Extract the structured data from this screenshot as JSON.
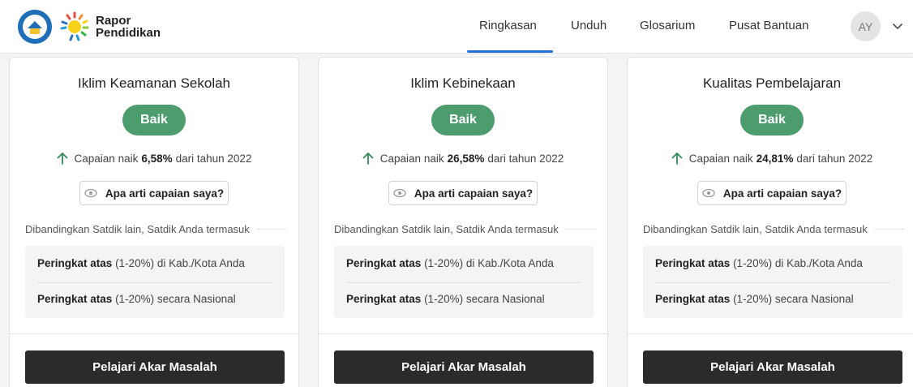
{
  "header": {
    "brand_line1": "Rapor",
    "brand_line2": "Pendidikan",
    "nav": [
      "Ringkasan",
      "Unduh",
      "Glosarium",
      "Pusat Bantuan"
    ],
    "active_tab": "Ringkasan",
    "avatar_initials": "AY",
    "accent_color": "#1f6fd6"
  },
  "cards": [
    {
      "title": "Iklim Keamanan Sekolah",
      "badge": "Baik",
      "trend_prefix": "Capaian naik",
      "trend_value": "6,58%",
      "trend_suffix": "dari tahun 2022",
      "info_button": "Apa arti capaian saya?",
      "compare_label": "Dibandingkan Satdik lain, Satdik Anda termasuk",
      "rank1_bold": "Peringkat atas",
      "rank1_rest": "(1-20%) di Kab./Kota Anda",
      "rank2_bold": "Peringkat atas",
      "rank2_rest": "(1-20%) secara Nasional",
      "action": "Pelajari Akar Masalah"
    },
    {
      "title": "Iklim Kebinekaan",
      "badge": "Baik",
      "trend_prefix": "Capaian naik",
      "trend_value": "26,58%",
      "trend_suffix": "dari tahun 2022",
      "info_button": "Apa arti capaian saya?",
      "compare_label": "Dibandingkan Satdik lain, Satdik Anda termasuk",
      "rank1_bold": "Peringkat atas",
      "rank1_rest": "(1-20%) di Kab./Kota Anda",
      "rank2_bold": "Peringkat atas",
      "rank2_rest": "(1-20%) secara Nasional",
      "action": "Pelajari Akar Masalah"
    },
    {
      "title": "Kualitas Pembelajaran",
      "badge": "Baik",
      "trend_prefix": "Capaian naik",
      "trend_value": "24,81%",
      "trend_suffix": "dari tahun 2022",
      "info_button": "Apa arti capaian saya?",
      "compare_label": "Dibandingkan Satdik lain, Satdik Anda termasuk",
      "rank1_bold": "Peringkat atas",
      "rank1_rest": "(1-20%) di Kab./Kota Anda",
      "rank2_bold": "Peringkat atas",
      "rank2_rest": "(1-20%) secara Nasional",
      "action": "Pelajari Akar Masalah"
    }
  ],
  "colors": {
    "badge_green": "#4c9c6e",
    "trend_up": "#2f8a57",
    "action_dark": "#2b2b2d"
  },
  "icons": {
    "trend": "arrow-up-icon",
    "info": "eye-icon",
    "menu": "chevron-down-icon"
  }
}
